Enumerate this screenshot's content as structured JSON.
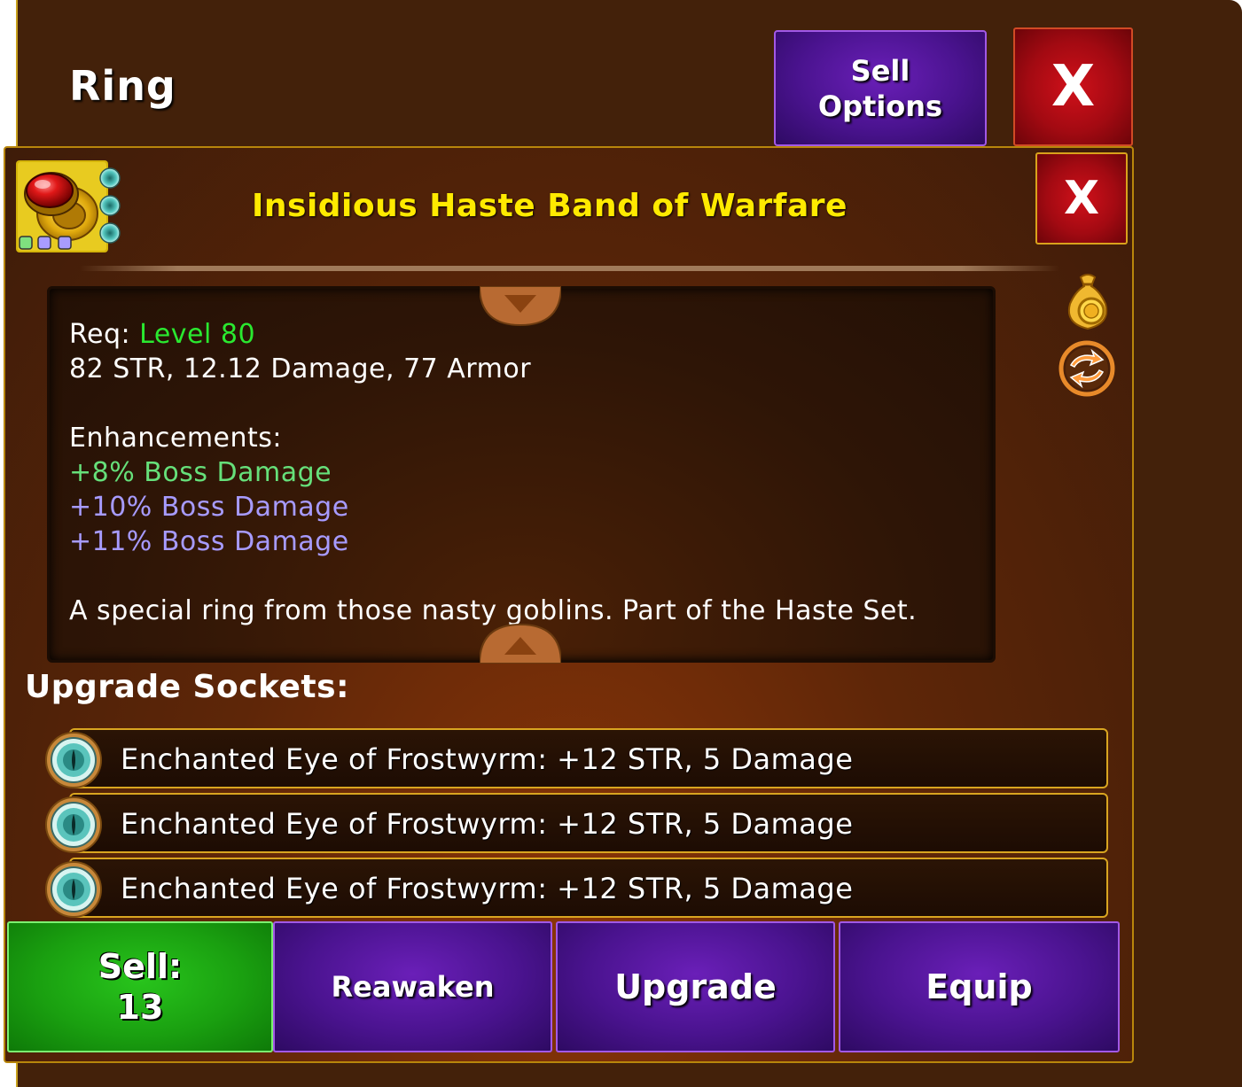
{
  "header": {
    "title": "Ring",
    "sell_options_line1": "Sell",
    "sell_options_line2": "Options",
    "close_label": "X"
  },
  "item": {
    "name": "Insidious Haste Band of Warfare",
    "close_label": "X",
    "icon": "red-gem-gold-ring-icon",
    "socket_indicators": [
      "#7fe07f",
      "#a89cff",
      "#a89cff"
    ]
  },
  "description": {
    "req_prefix": "Req: ",
    "req_level": "Level 80",
    "stats": "82 STR, 12.12 Damage, 77 Armor",
    "enhancements_label": "Enhancements:",
    "enhancements": [
      "+8% Boss Damage",
      "+10% Boss Damage",
      "+11% Boss Damage"
    ],
    "flavor": "A special ring from those nasty goblins. Part of the Haste Set."
  },
  "side_icons": [
    "gold-bag-icon",
    "refresh-cycle-icon"
  ],
  "sockets": {
    "label": "Upgrade Sockets:",
    "items": [
      {
        "text": "Enchanted Eye of Frostwyrm: +12 STR, 5 Damage",
        "icon": "frost-eye-gem-icon"
      },
      {
        "text": "Enchanted Eye of Frostwyrm: +12 STR, 5 Damage",
        "icon": "frost-eye-gem-icon"
      },
      {
        "text": "Enchanted Eye of Frostwyrm: +12 STR, 5 Damage",
        "icon": "frost-eye-gem-icon"
      }
    ]
  },
  "actions": {
    "sell_label": "Sell:",
    "sell_value": "13",
    "reawaken": "Reawaken",
    "upgrade": "Upgrade",
    "equip": "Equip"
  },
  "colors": {
    "background": "#43210a",
    "item_name": "#ffea00",
    "level_green": "#2ae830",
    "enh_green": "#66e07a",
    "enh_purple": "#a79bff",
    "button_purple": "#4a138f",
    "button_green": "#1aa010",
    "button_red": "#a30a12"
  }
}
